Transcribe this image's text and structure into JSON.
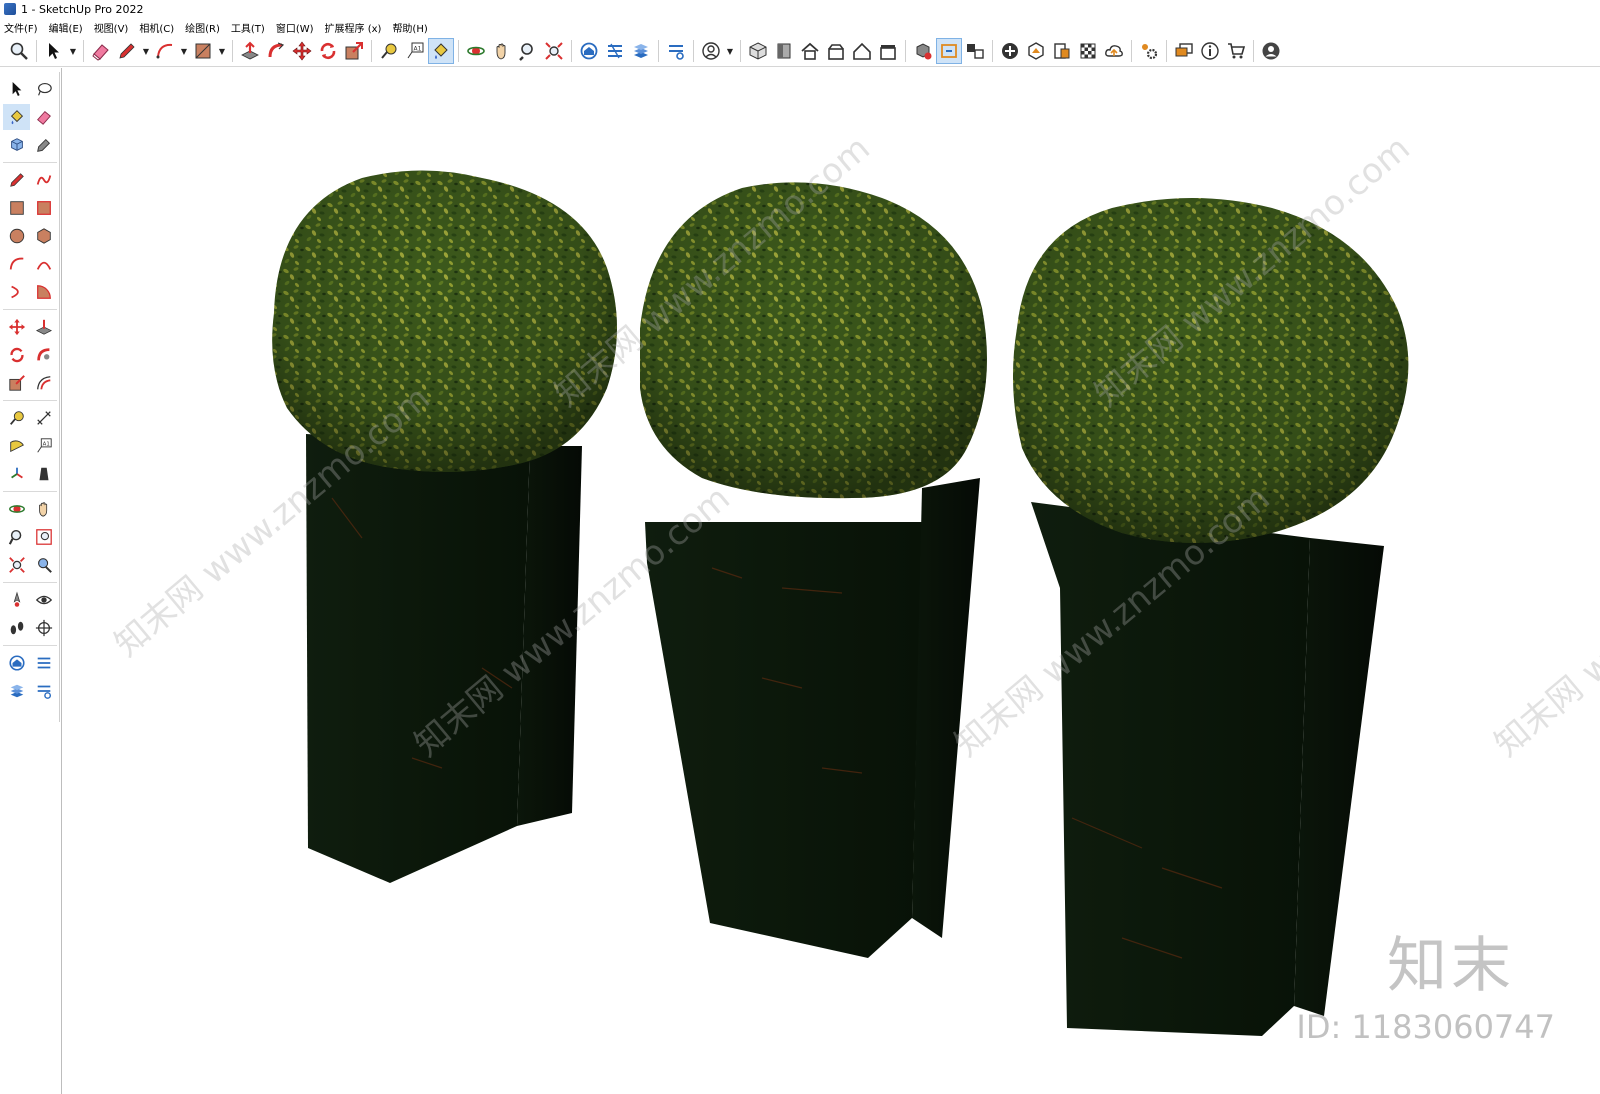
{
  "window": {
    "title": "1 - SketchUp Pro 2022"
  },
  "menubar": {
    "items": [
      "文件(F)",
      "编辑(E)",
      "视图(V)",
      "相机(C)",
      "绘图(R)",
      "工具(T)",
      "窗口(W)",
      "扩展程序 (x)",
      "帮助(H)"
    ]
  },
  "toolbar": {
    "icons": [
      "zoom-extents-icon",
      "select-icon",
      "eraser-icon",
      "pencil-line-icon",
      "arc-icon",
      "rectangle-icon",
      "push-pull-icon",
      "follow-me-icon",
      "move-icon",
      "rotate-icon",
      "scale-icon",
      "tape-measure-icon",
      "text-icon",
      "paint-bucket-icon",
      "orbit-icon",
      "pan-icon",
      "zoom-icon",
      "zoom-extents-2-icon",
      "warehouse-icon",
      "extension-warehouse-icon",
      "layout-icon",
      "styles-icon",
      "account-icon",
      "iso-view-icon",
      "front-view-icon",
      "house-icon",
      "top-view-icon",
      "right-view-icon",
      "back-view-icon",
      "solid-tools-icon",
      "section-plane-icon",
      "section-display-icon",
      "add-location-icon",
      "terrain-icon",
      "photo-texture-icon",
      "xray-icon",
      "cloud-icon",
      "settings-icon",
      "message-icon",
      "info-icon",
      "cart-icon",
      "user-icon"
    ]
  },
  "viewport": {
    "background": "#ffffff",
    "planter_color": "#0d1a0c",
    "foliage_dark": "#2d4a17",
    "foliage_light": "#8a9a2e"
  },
  "watermark": {
    "diagonal_text": "知末网 www.znzmo.com",
    "logo": "知末",
    "id_text": "ID: 1183060747"
  }
}
